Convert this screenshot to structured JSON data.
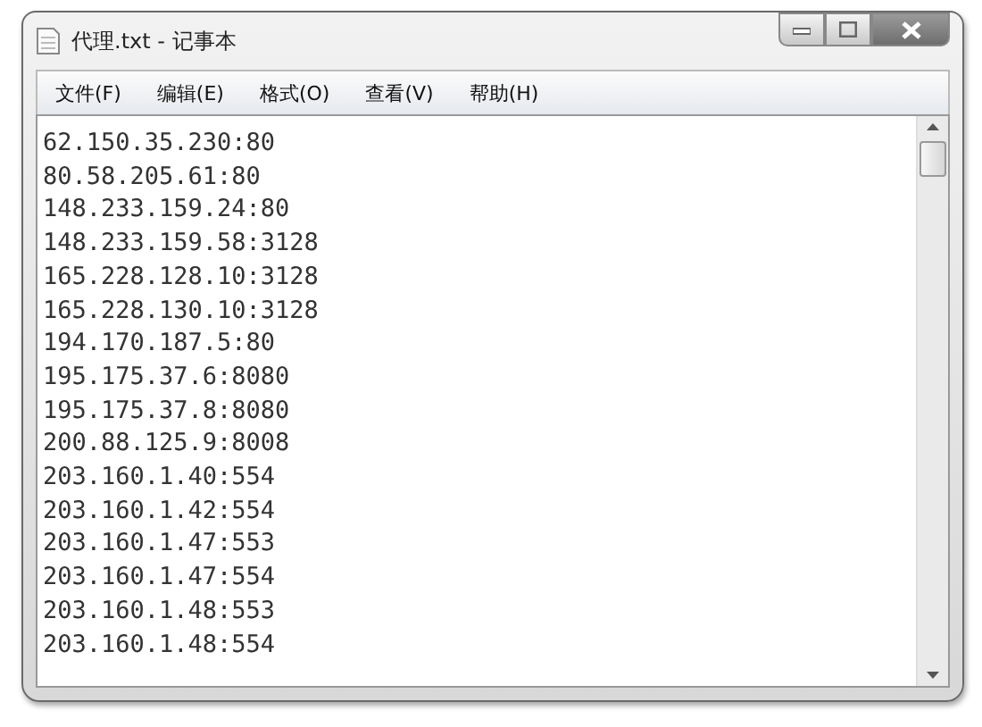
{
  "window": {
    "title": "代理.txt - 记事本"
  },
  "menu": [
    "文件(F)",
    "编辑(E)",
    "格式(O)",
    "查看(V)",
    "帮助(H)"
  ],
  "lines": [
    "62.150.35.230:80",
    "80.58.205.61:80",
    "148.233.159.24:80",
    "148.233.159.58:3128",
    "165.228.128.10:3128",
    "165.228.130.10:3128",
    "194.170.187.5:80",
    "195.175.37.6:8080",
    "195.175.37.8:8080",
    "200.88.125.9:8008",
    "203.160.1.40:554",
    "203.160.1.42:554",
    "203.160.1.47:553",
    "203.160.1.47:554",
    "203.160.1.48:553",
    "203.160.1.48:554"
  ]
}
